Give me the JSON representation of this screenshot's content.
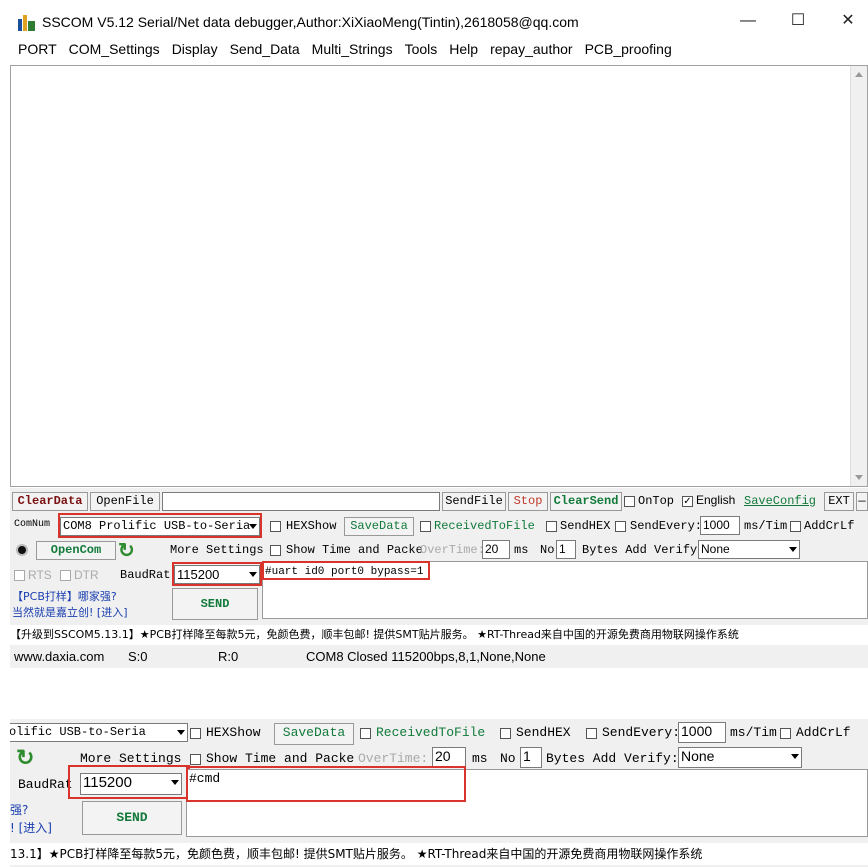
{
  "window": {
    "title": "SSCOM V5.12 Serial/Net data debugger,Author:XiXiaoMeng(Tintin),2618058@qq.com",
    "minimize_glyph": "—",
    "maximize_glyph": "☐",
    "close_glyph": "✕"
  },
  "menu": [
    "PORT",
    "COM_Settings",
    "Display",
    "Send_Data",
    "Multi_Strings",
    "Tools",
    "Help",
    "repay_author",
    "PCB_proofing"
  ],
  "toolbar1": {
    "clear_data": "ClearData",
    "open_file": "OpenFile",
    "file_path": "",
    "send_file": "SendFile",
    "stop": "Stop",
    "clear_send": "ClearSend",
    "on_top": "OnTop",
    "english": "English",
    "save_config": "SaveConfig",
    "ext": "EXT",
    "dash": "—"
  },
  "row2": {
    "comnum_label": "ComNum",
    "com_value": "COM8 Prolific USB-to-Seria",
    "hexshow": "HEXShow",
    "save_data": "SaveData",
    "received_to_file": "ReceivedToFile",
    "send_hex": "SendHEX",
    "send_every": "SendEvery:",
    "send_every_value": "1000",
    "ms_tim": "ms/Tim",
    "add_crlf": "AddCrLf"
  },
  "row3": {
    "open_com": "OpenCom",
    "more_settings": "More Settings",
    "show_time": "Show Time and Packe",
    "overtime": "OverTime:",
    "overtime_value": "20",
    "ms": "ms",
    "no": "No",
    "no_value": "1",
    "bytes_add_verify": "Bytes Add Verify:",
    "verify_value": "None"
  },
  "row4": {
    "rts": "RTS",
    "dtr": "DTR",
    "baud_label": "BaudRat",
    "baud_value": "115200",
    "send_text": "#uart id0 port0 bypass=1"
  },
  "promo": {
    "line1": "【PCB打样】哪家强?",
    "line2": "当然就是嘉立创! [进入]",
    "send": "SEND"
  },
  "ticker": "【升级到SSCOM5.13.1】★PCB打样降至每款5元，免颜色费，顺丰包邮! 提供SMT贴片服务。 ★RT-Thread来自中国的开源免费商用物联网操作系统",
  "status": {
    "site": "www.daxia.com",
    "s": "S:0",
    "r": "R:0",
    "port_state": "COM8 Closed  115200bps,8,1,None,None"
  },
  "crop": {
    "com_value": "olific USB-to-Seria",
    "hexshow": "HEXShow",
    "save_data": "SaveData",
    "received_to_file": "ReceivedToFile",
    "send_hex": "SendHEX",
    "send_every": "SendEvery:",
    "send_every_value": "1000",
    "ms_tim": "ms/Tim",
    "add_crlf": "AddCrLf",
    "more_settings": "More Settings",
    "show_time": "Show Time and Packe",
    "overtime": "OverTime:",
    "overtime_value": "20",
    "ms": "ms",
    "no": "No",
    "no_value": "1",
    "bytes_add_verify": "Bytes Add Verify:",
    "verify_value": "None",
    "baud_label": "BaudRat",
    "baud_value": "115200",
    "send_text": "#cmd",
    "promo1": "强?",
    "promo2": "! [进入]",
    "send": "SEND",
    "ticker": "13.1】★PCB打样降至每款5元，免颜色费，顺丰包邮! 提供SMT贴片服务。 ★RT-Thread来自中国的开源免费商用物联网操作系统"
  }
}
